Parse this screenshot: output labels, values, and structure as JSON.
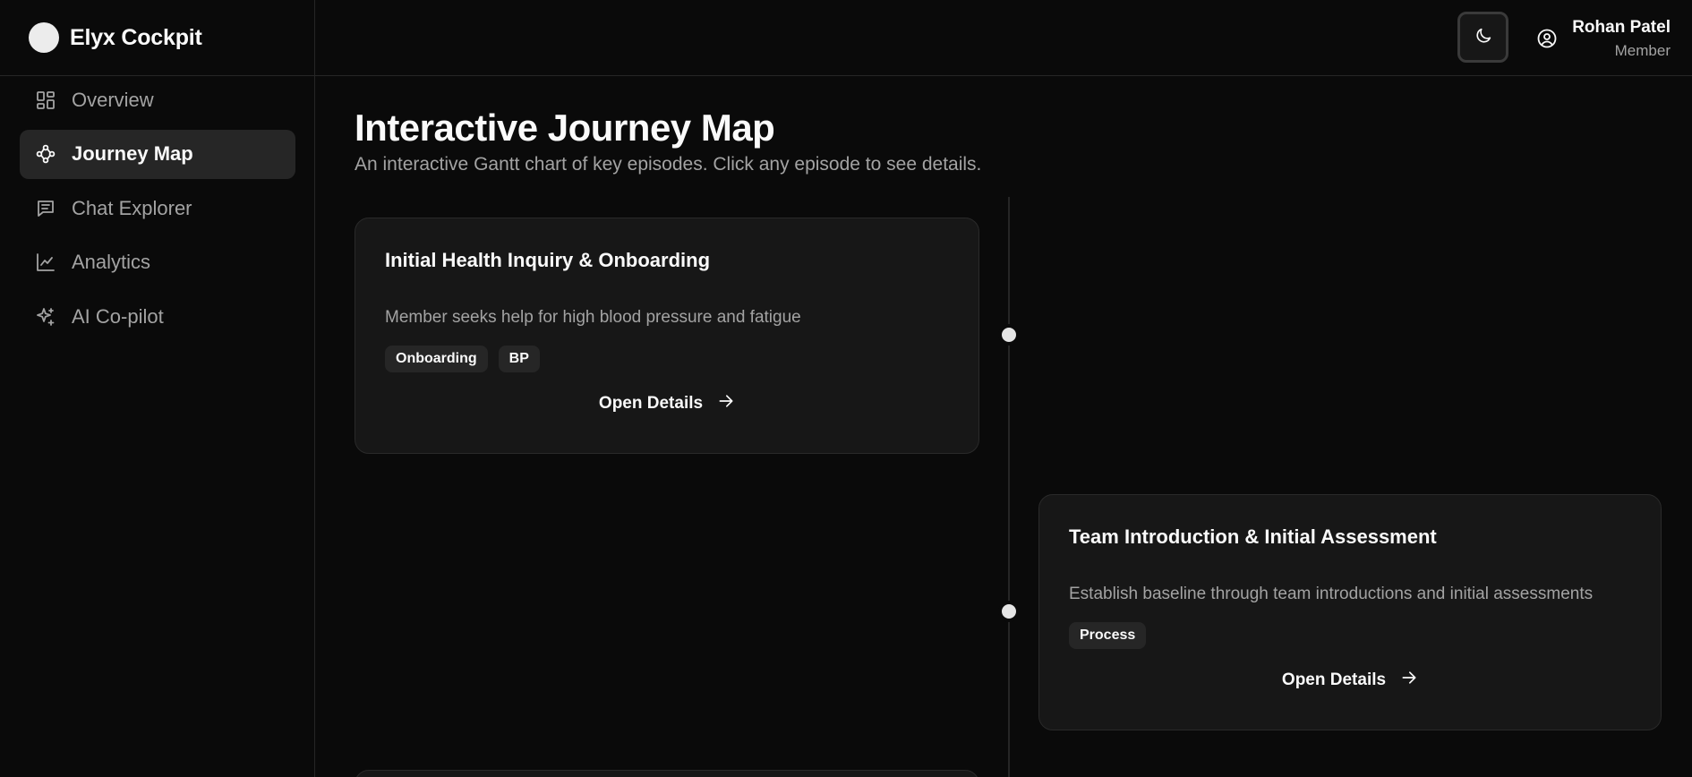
{
  "brand": {
    "name": "Elyx Cockpit"
  },
  "sidebar": {
    "items": [
      {
        "label": "Overview",
        "icon": "layout-dashboard-icon",
        "active": false
      },
      {
        "label": "Journey Map",
        "icon": "route-icon",
        "active": true
      },
      {
        "label": "Chat Explorer",
        "icon": "message-square-text-icon",
        "active": false
      },
      {
        "label": "Analytics",
        "icon": "line-chart-icon",
        "active": false
      },
      {
        "label": "AI Co-pilot",
        "icon": "sparkles-icon",
        "active": false
      }
    ]
  },
  "header": {
    "theme_toggle_icon": "moon-icon",
    "user": {
      "name": "Rohan Patel",
      "role": "Member",
      "icon": "user-circle-icon"
    }
  },
  "main": {
    "title": "Interactive Journey Map",
    "subtitle": "An interactive Gantt chart of key episodes. Click any episode to see details.",
    "episodes": [
      {
        "title": "Initial Health Inquiry & Onboarding",
        "description": "Member seeks help for high blood pressure and fatigue",
        "tags": [
          "Onboarding",
          "BP"
        ],
        "action_label": "Open Details",
        "side": "left"
      },
      {
        "title": "Team Introduction & Initial Assessment",
        "description": "Establish baseline through team introductions and initial assessments",
        "tags": [
          "Process"
        ],
        "action_label": "Open Details",
        "side": "right"
      }
    ]
  },
  "colors": {
    "background": "#0a0a0a",
    "card": "#171717",
    "border": "#262626",
    "text": "#fafafa",
    "muted": "#a3a3a3",
    "dot": "#e5e5e5"
  }
}
